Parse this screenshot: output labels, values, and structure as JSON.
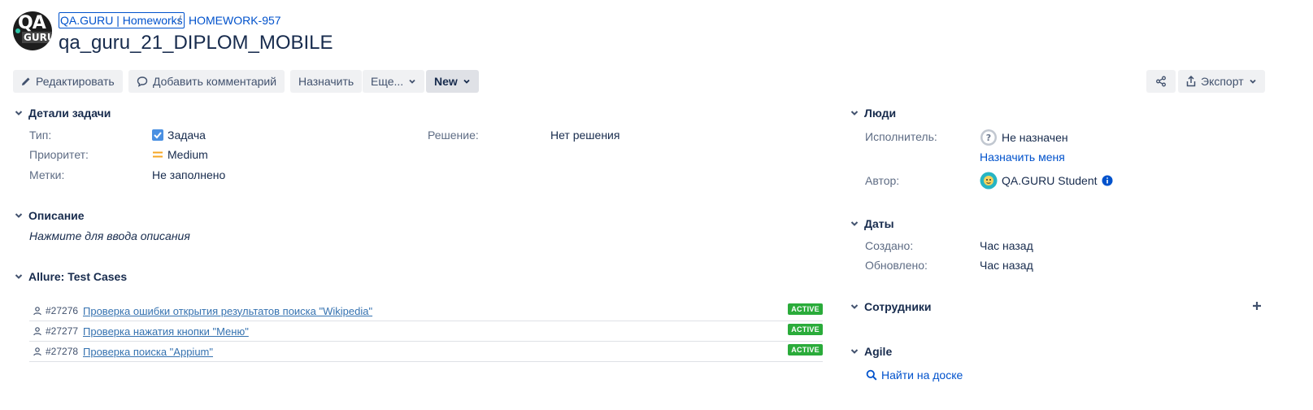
{
  "header": {
    "logo_text_top": "QA",
    "logo_text_bottom": "GURU",
    "breadcrumb_project": "QA.GURU | Homeworks",
    "breadcrumb_separator": "/",
    "breadcrumb_issue": "HOMEWORK-957",
    "title": "qa_guru_21_DIPLOM_MOBILE"
  },
  "toolbar": {
    "edit_label": "Редактировать",
    "comment_label": "Добавить комментарий",
    "assign_label": "Назначить",
    "more_label": "Еще...",
    "status_label": "New",
    "export_label": "Экспорт"
  },
  "details": {
    "header": "Детали задачи",
    "type_label": "Тип:",
    "type_value": "Задача",
    "priority_label": "Приоритет:",
    "priority_value": "Medium",
    "labels_label": "Метки:",
    "labels_value": "Не заполнено",
    "resolution_label": "Решение:",
    "resolution_value": "Нет решения"
  },
  "description": {
    "header": "Описание",
    "placeholder": "Нажмите для ввода описания"
  },
  "allure": {
    "header": "Allure: Test Cases",
    "rows": [
      {
        "id": "#27276",
        "title": "Проверка ошибки открытия результатов поиска \"Wikipedia\"",
        "status": "ACTIVE"
      },
      {
        "id": "#27277",
        "title": "Проверка нажатия кнопки \"Меню\"",
        "status": "ACTIVE"
      },
      {
        "id": "#27278",
        "title": "Проверка поиска \"Appium\"",
        "status": "ACTIVE"
      }
    ]
  },
  "people": {
    "header": "Люди",
    "assignee_label": "Исполнитель:",
    "assignee_value": "Не назначен",
    "assign_me": "Назначить меня",
    "reporter_label": "Автор:",
    "reporter_value": "QA.GURU Student"
  },
  "dates": {
    "header": "Даты",
    "created_label": "Создано:",
    "created_value": "Час назад",
    "updated_label": "Обновлено:",
    "updated_value": "Час назад"
  },
  "watchers": {
    "header": "Сотрудники"
  },
  "agile": {
    "header": "Agile",
    "find_on_board": "Найти на доске"
  },
  "colors": {
    "link": "#0052cc",
    "active_badge": "#2aab3a",
    "priority": "#f5a623",
    "checkbox": "#4a90e2"
  }
}
